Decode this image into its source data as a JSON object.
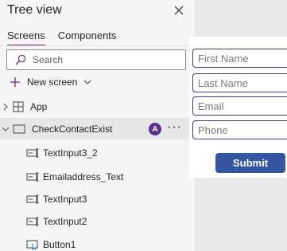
{
  "pane": {
    "title": "Tree view",
    "tabs": [
      {
        "label": "Screens",
        "active": true
      },
      {
        "label": "Components",
        "active": false
      }
    ],
    "search_placeholder": "Search",
    "new_screen_label": "New screen"
  },
  "tree": {
    "app": {
      "label": "App",
      "icon": "app-grid-icon"
    },
    "screen": {
      "label": "CheckContactExist",
      "icon": "screen-icon",
      "avatar_initial": "A",
      "more": "···",
      "children": [
        {
          "label": "TextInput3_2",
          "icon": "text-input-icon"
        },
        {
          "label": "Emailaddress_Text",
          "icon": "text-input-icon"
        },
        {
          "label": "TextInput3",
          "icon": "text-input-icon"
        },
        {
          "label": "TextInput2",
          "icon": "text-input-icon"
        },
        {
          "label": "Button1",
          "icon": "button-icon"
        }
      ]
    }
  },
  "form": {
    "first_name_placeholder": "First Name",
    "last_name_placeholder": "Last Name",
    "email_placeholder": "Email",
    "phone_placeholder": "Phone",
    "submit_label": "Submit"
  },
  "colors": {
    "accent": "#742774",
    "avatar": "#5c2e91",
    "submit": "#3455a0",
    "field_border": "#3a3a8c"
  }
}
